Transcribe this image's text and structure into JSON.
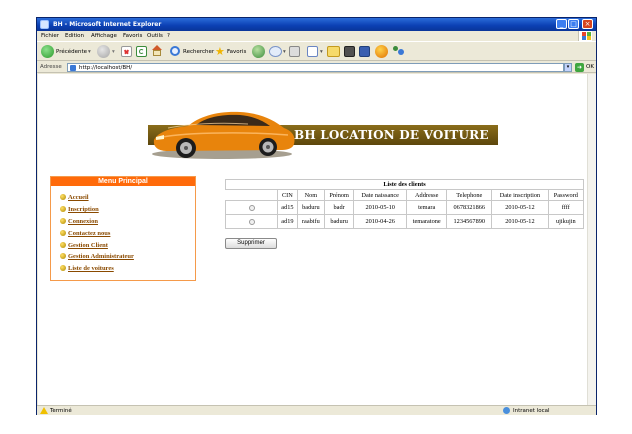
{
  "window": {
    "title": "BH - Microsoft Internet Explorer",
    "minimize": "_",
    "maximize": "□",
    "close": "×"
  },
  "menubar": [
    "Fichier",
    "Edition",
    "Affichage",
    "Favoris",
    "Outils",
    "?"
  ],
  "toolbar": {
    "back": "Précédente",
    "search": "Rechercher",
    "favorites": "Favoris"
  },
  "address": {
    "label": "Adresse",
    "url": "http://localhost/BH/",
    "go": "OK"
  },
  "status": {
    "text": "Terminé",
    "zone": "Intranet local"
  },
  "page": {
    "banner_title": "BH LOCATION DE VOITURE",
    "menu": {
      "title": "Menu Principal",
      "items": [
        "Accueil",
        "Inscription",
        "Connexion",
        "Contactez nous",
        "Gestion Client",
        "Gestion Administrateur",
        "Liste de voitures"
      ]
    },
    "clients": {
      "caption": "Liste des clients",
      "headers": [
        "CIN",
        "Nom",
        "Prénom",
        "Date naissance",
        "Addresse",
        "Telephone",
        "Date inscription",
        "Password"
      ],
      "rows": [
        [
          "ad15",
          "baduru",
          "badr",
          "2010-05-10",
          "temara",
          "0678321866",
          "2010-05-12",
          "ffff"
        ],
        [
          "ad19",
          "raabifu",
          "baduru",
          "2010-04-26",
          "temaratone",
          "1234567890",
          "2010-05-12",
          "ujikujin"
        ]
      ],
      "delete_label": "Supprimer"
    }
  },
  "colors": {
    "menu_header": "#ff6a0a",
    "menu_border": "#f59a4a",
    "link": "#8a4a00",
    "titlebar": "#0b3fb3",
    "car": "#e8840c"
  }
}
